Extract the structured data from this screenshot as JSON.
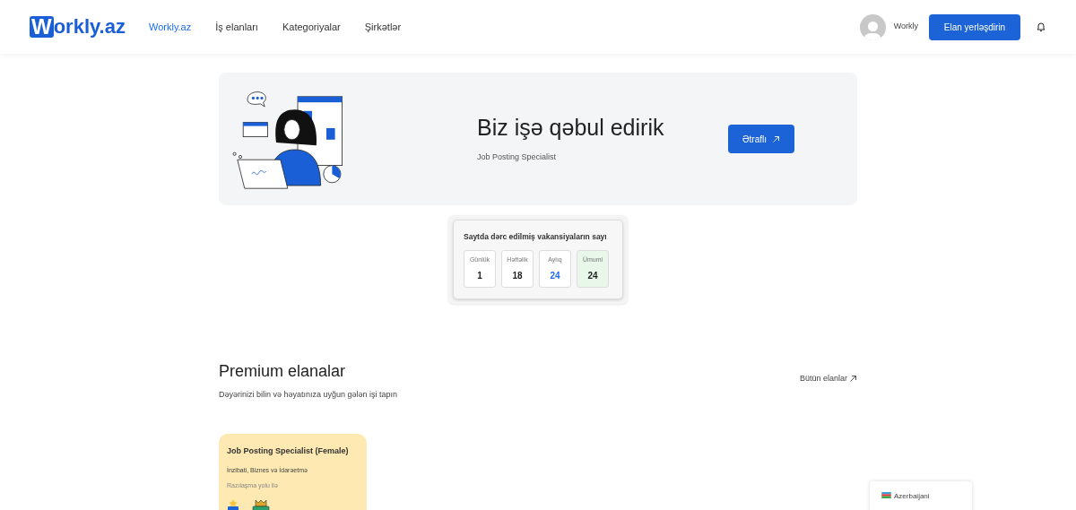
{
  "header": {
    "logo_initial": "W",
    "logo_rest": "orkly.az",
    "nav": [
      {
        "label": "Workly.az",
        "selected": true
      },
      {
        "label": "İş elanları",
        "selected": false
      },
      {
        "label": "Kategoriyalar",
        "selected": false
      },
      {
        "label": "Şirkətlər",
        "selected": false
      }
    ],
    "user_name": "Workly",
    "post_button": "Elan yerləşdirin"
  },
  "hero": {
    "title": "Biz işə qəbul edirik",
    "subtitle": "Job Posting Specialist",
    "button": "Ətraflı"
  },
  "stats": {
    "title": "Saytda dərc edilmiş vakansiyaların sayı",
    "items": [
      {
        "label": "Günlük",
        "value": "1",
        "kind": "plain"
      },
      {
        "label": "Həftəlik",
        "value": "18",
        "kind": "plain"
      },
      {
        "label": "Aylıq",
        "value": "24",
        "kind": "accent"
      },
      {
        "label": "Ümumi",
        "value": "24",
        "kind": "total"
      }
    ]
  },
  "premium": {
    "title": "Premium elanalar",
    "subtitle": "Dəyərinizi bilin və həyatınıza uyğun gələn işi tapın",
    "all_link": "Bütün elanlar",
    "cards": [
      {
        "title": "Job Posting Specialist (Female)",
        "category": "İnzibati, Biznes və İdarəetmə",
        "salary": "Razılaşma yolu ilə",
        "vip": true,
        "premium": true
      }
    ]
  },
  "language": {
    "label": "Azerbaijani"
  }
}
